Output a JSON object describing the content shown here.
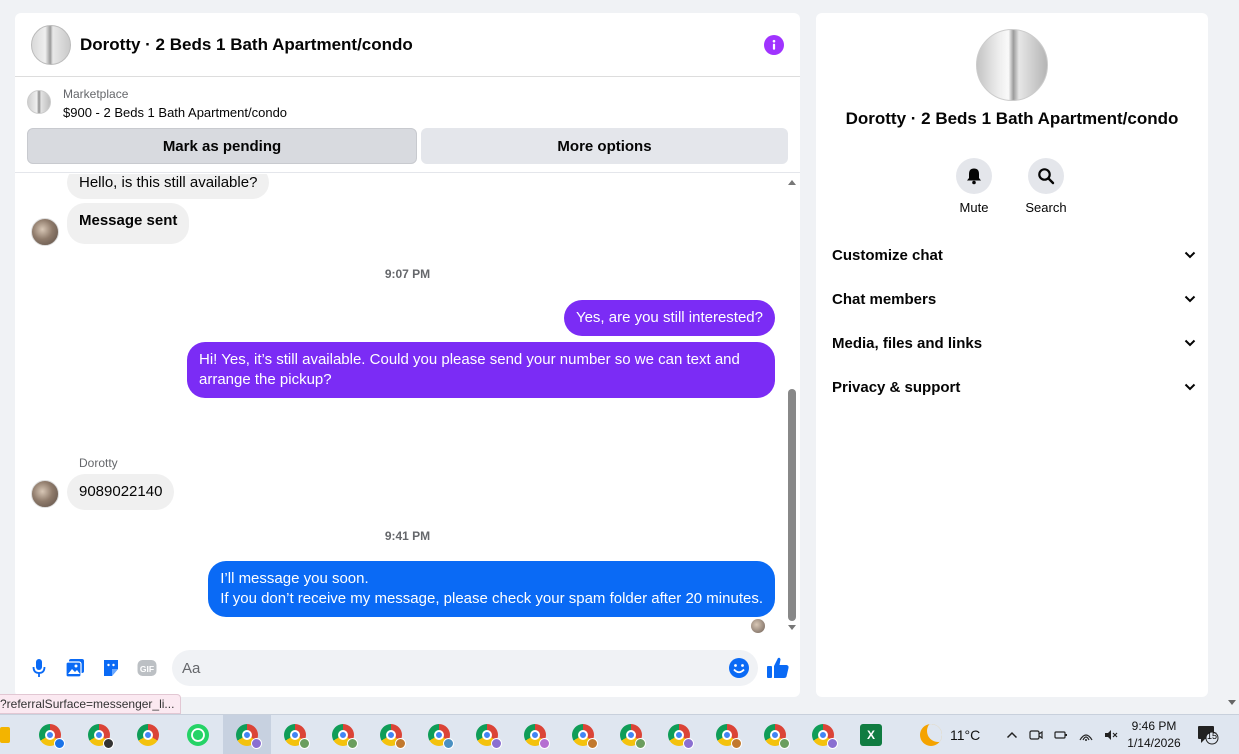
{
  "chat": {
    "title": "Dorotty · 2 Beds 1 Bath Apartment/condo",
    "marketplace_label": "Marketplace",
    "listing": "$900 - 2 Beds 1 Bath Apartment/condo",
    "mark_pending": "Mark as pending",
    "more_options": "More options",
    "messages": [
      {
        "text": "Hello, is this still available?"
      },
      {
        "text": "Message sent"
      },
      {
        "time": "9:07 PM"
      },
      {
        "text": "Yes, are you still interested?"
      },
      {
        "line1": "Hi! Yes, it’s still available. Could you please send your number so we can text and",
        "line2": "arrange the pickup?"
      },
      {
        "sender": "Dorotty"
      },
      {
        "text": "9089022140"
      },
      {
        "time": "9:41 PM"
      },
      {
        "line1": "I’ll message you soon.",
        "line2": "If you don’t receive my message, please check your spam folder after 20 minutes."
      }
    ],
    "composer_placeholder": "Aa",
    "colors": {
      "accent": "#a033ff",
      "outgoing_purple": "#7b2cf5",
      "outgoing_blue": "#0a6af5",
      "incoming": "#f0f0f0"
    }
  },
  "info": {
    "name": "Dorotty · 2 Beds 1 Bath Apartment/condo",
    "mute": "Mute",
    "search": "Search",
    "sections": [
      "Customize chat",
      "Chat members",
      "Media, files and links",
      "Privacy & support"
    ]
  },
  "status_link": "?referralSurface=messenger_li...",
  "taskbar": {
    "temperature": "11°C",
    "time": "9:46 PM",
    "date": "1/14/2026",
    "notifications": "15",
    "excel_letter": "X",
    "app_icons": [
      "chrome-icon",
      "whatsapp-icon",
      "excel-icon"
    ]
  }
}
